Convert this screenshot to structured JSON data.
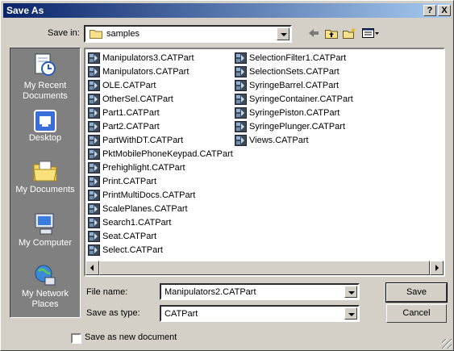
{
  "window": {
    "title": "Save As",
    "help_button": "?",
    "close_button": "X"
  },
  "save_in": {
    "label": "Save in:",
    "value": "samples",
    "toolbar": [
      "back-arrow-icon",
      "up-one-level-icon",
      "new-folder-icon",
      "view-menu-icon"
    ]
  },
  "places": [
    {
      "label": "My Recent Documents",
      "icon": "recent-documents-icon"
    },
    {
      "label": "Desktop",
      "icon": "desktop-icon"
    },
    {
      "label": "My Documents",
      "icon": "my-documents-icon"
    },
    {
      "label": "My Computer",
      "icon": "my-computer-icon"
    },
    {
      "label": "My Network Places",
      "icon": "network-places-icon"
    }
  ],
  "files": {
    "column1": [
      "Manipulators3.CATPart",
      "Manipulators.CATPart",
      "OLE.CATPart",
      "OtherSel.CATPart",
      "Part1.CATPart",
      "Part2.CATPart",
      "PartWithDT.CATPart",
      "PktMobilePhoneKeypad.CATPart",
      "Prehighlight.CATPart",
      "Print.CATPart",
      "PrintMultiDocs.CATPart",
      "ScalePlanes.CATPart",
      "Search1.CATPart",
      "Seat.CATPart",
      "Select.CATPart"
    ],
    "column2": [
      "SelectionFilter1.CATPart",
      "SelectionSets.CATPart",
      "SyringeBarrel.CATPart",
      "SyringeContainer.CATPart",
      "SyringePiston.CATPart",
      "SyringePlunger.CATPart",
      "Views.CATPart"
    ]
  },
  "file_name": {
    "label": "File name:",
    "value": "Manipulators2.CATPart"
  },
  "save_as_type": {
    "label": "Save as type:",
    "value": "CATPart"
  },
  "buttons": {
    "save": "Save",
    "cancel": "Cancel"
  },
  "save_as_new_document": {
    "label": "Save as new document",
    "checked": false
  }
}
